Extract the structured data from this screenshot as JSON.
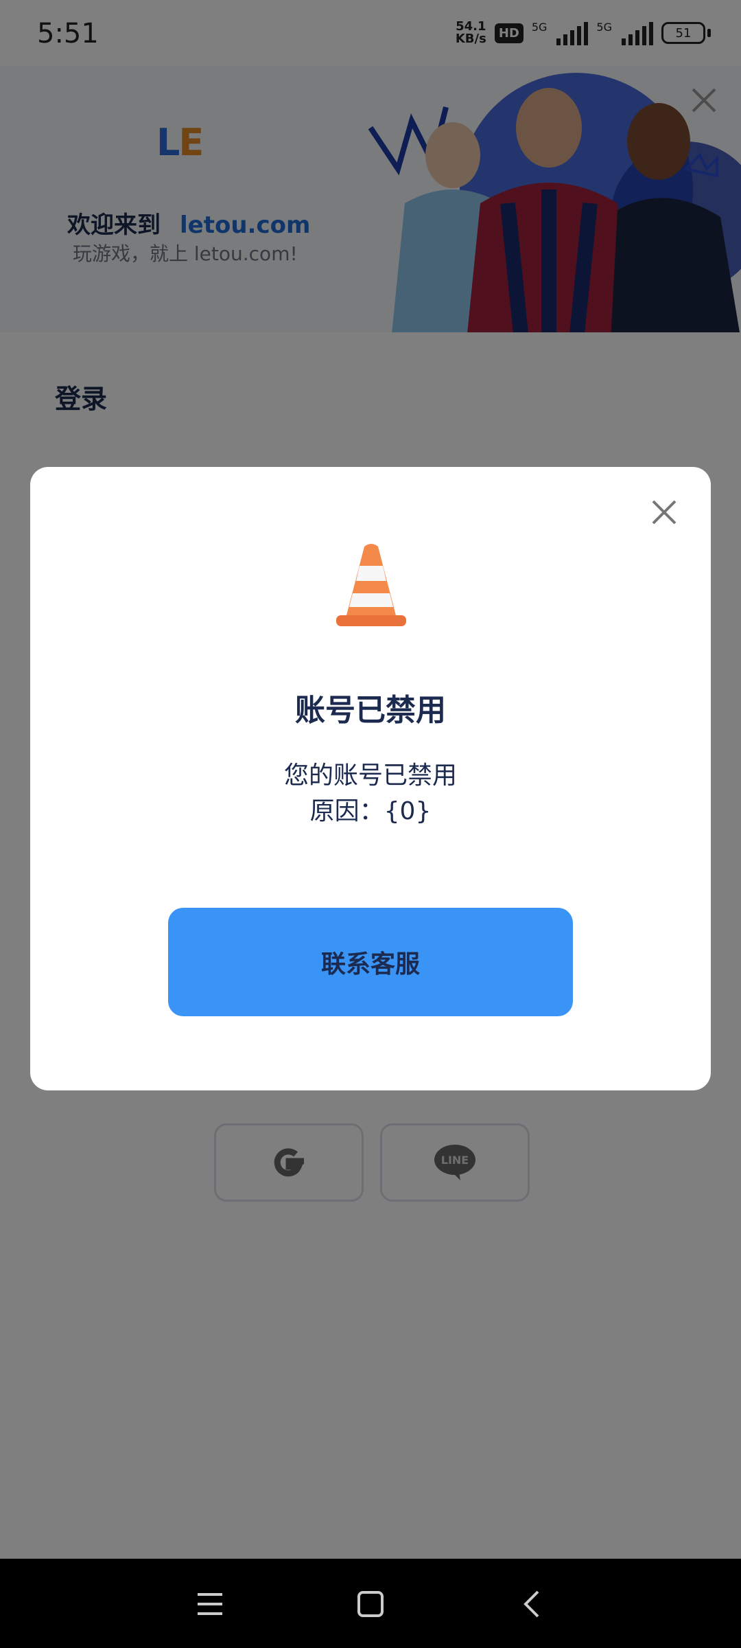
{
  "status_bar": {
    "time": "5:51",
    "net_speed_value": "54.1",
    "net_speed_unit": "KB/s",
    "hd_badge": "HD",
    "sim1_label": "5G",
    "sim2_label": "5G",
    "battery": "51"
  },
  "banner": {
    "logo_l": "L",
    "logo_e": "E",
    "welcome": "欢迎来到",
    "brand": "letou.com",
    "tagline": "玩游戏，就上 letou.com!",
    "players_image": "football-players"
  },
  "login": {
    "title": "登录"
  },
  "social": [
    {
      "icon": "google-icon"
    },
    {
      "icon": "line-icon",
      "label": "LINE"
    }
  ],
  "dialog": {
    "icon": "traffic-cone-icon",
    "title": "账号已禁用",
    "message_line1": "您的账号已禁用",
    "message_line2": "原因：{0}",
    "button_label": "联系客服"
  },
  "colors": {
    "primary_button": "#3a94f5",
    "text_dark": "#1b2a4e",
    "brand_blue": "#1e6ad6",
    "logo_orange": "#e08a26"
  }
}
